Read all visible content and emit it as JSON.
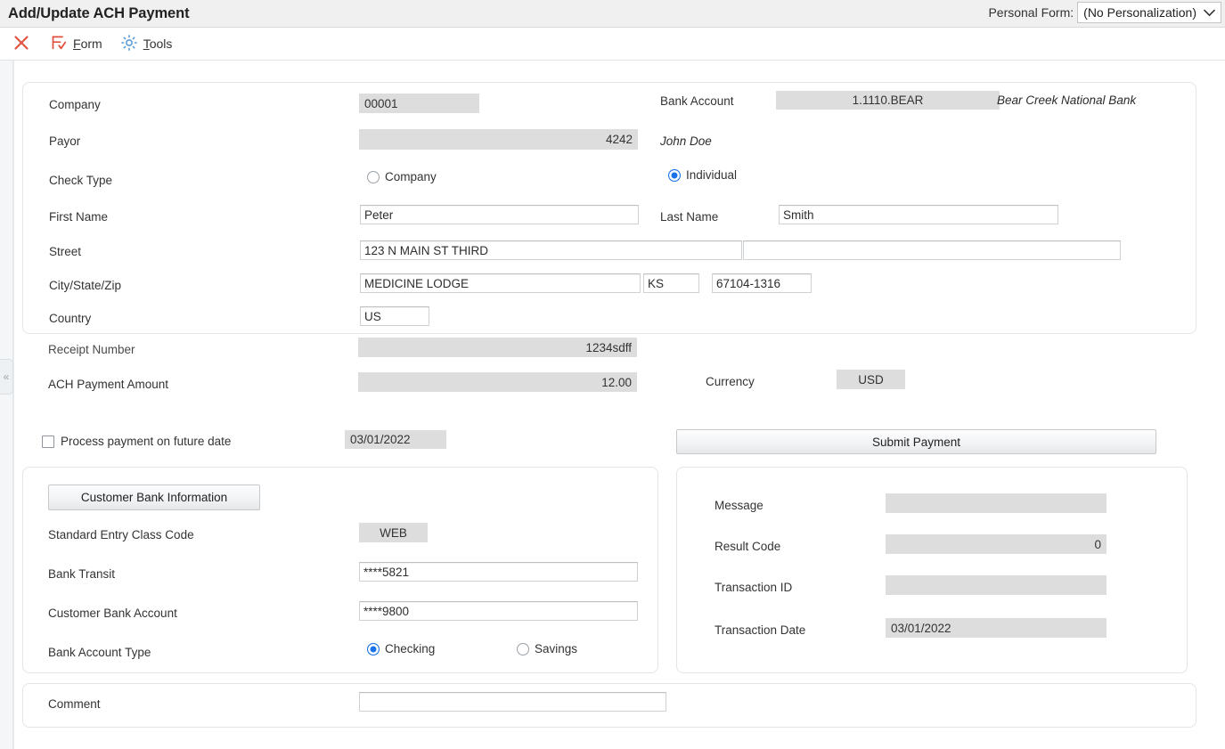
{
  "window": {
    "title": "Add/Update ACH Payment"
  },
  "personal_form": {
    "label": "Personal Form:",
    "value": "(No Personalization)",
    "options": [
      "(No Personalization)"
    ],
    "chevron": "⌄"
  },
  "toolbar": {
    "close_icon": "close-icon",
    "items": [
      {
        "name": "form",
        "label": "Form",
        "accel": "F",
        "icon": "form-icon"
      },
      {
        "name": "tools",
        "label": "Tools",
        "accel": "T",
        "icon": "gear-icon"
      }
    ]
  },
  "left_rail": {
    "collapse_glyph": "«"
  },
  "main_panel": {
    "company": {
      "label": "Company",
      "value": "00001"
    },
    "bank_account": {
      "label": "Bank Account",
      "value": "1.1110.BEAR",
      "description": "Bear Creek National Bank"
    },
    "payor": {
      "label": "Payor",
      "value": "4242",
      "description": "John Doe"
    },
    "check_type": {
      "label": "Check Type",
      "options": [
        {
          "label": "Company",
          "selected": false
        },
        {
          "label": "Individual",
          "selected": true
        }
      ]
    },
    "first_name": {
      "label": "First Name",
      "value": "Peter"
    },
    "last_name": {
      "label": "Last Name",
      "value": "Smith"
    },
    "street": {
      "label": "Street",
      "value": "123 N MAIN ST THIRD",
      "value2": ""
    },
    "city_state_zip": {
      "label": "City/State/Zip",
      "city": "MEDICINE LODGE",
      "state": "KS",
      "zip": "67104-1316"
    },
    "country": {
      "label": "Country",
      "value": "US"
    },
    "receipt_number": {
      "label": "Receipt Number",
      "value": "1234sdff"
    },
    "ach_payment_amount": {
      "label": "ACH Payment Amount",
      "value": "12.00"
    },
    "currency": {
      "label": "Currency",
      "value": "USD"
    }
  },
  "future_date": {
    "checkbox_label": "Process payment on future date",
    "checked": false,
    "date": "03/01/2022"
  },
  "submit": {
    "label": "Submit Payment"
  },
  "customer_bank": {
    "button_label": "Customer Bank Information",
    "sec_code": {
      "label": "Standard Entry Class Code",
      "value": "WEB"
    },
    "bank_transit": {
      "label": "Bank Transit",
      "value": "****5821"
    },
    "customer_bank_account": {
      "label": "Customer Bank Account",
      "value": "****9800"
    },
    "account_type": {
      "label": "Bank Account Type",
      "options": [
        {
          "label": "Checking",
          "selected": true
        },
        {
          "label": "Savings",
          "selected": false
        }
      ]
    }
  },
  "result_panel": {
    "message": {
      "label": "Message",
      "value": ""
    },
    "result_code": {
      "label": "Result Code",
      "value": "0"
    },
    "transaction_id": {
      "label": "Transaction ID",
      "value": ""
    },
    "transaction_date": {
      "label": "Transaction Date",
      "value": "03/01/2022"
    }
  },
  "comment": {
    "label": "Comment",
    "value": ""
  },
  "colors": {
    "accent": "#1a73e8",
    "icon_red": "#e0503f",
    "icon_blue": "#5b9bd5",
    "readonly_bg": "#dddddd",
    "header_bg": "#f0f0f0",
    "body_bg": "#f4f6f8"
  }
}
